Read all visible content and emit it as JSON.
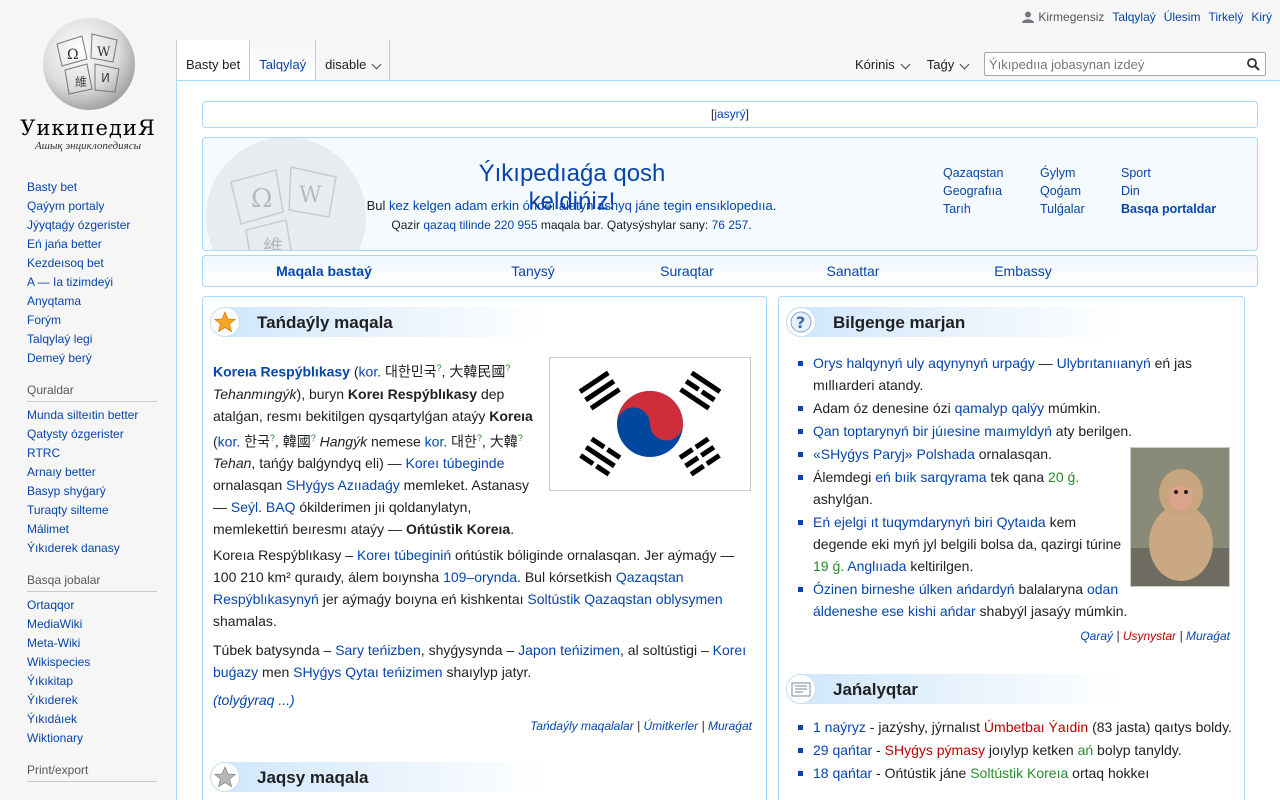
{
  "logo": {
    "wordmark": "УикипедиЯ",
    "tagline": "Ашық энциклопедиясы"
  },
  "personal": {
    "anon": "Kirmegensiz",
    "items": [
      "Talqylaý",
      "Úlesim",
      "Tirkelý",
      "Kirý"
    ]
  },
  "tabs": {
    "left": [
      "Basty bet",
      "Talqylaý",
      "disable"
    ],
    "right": [
      "Kórinis",
      "Taǵy"
    ]
  },
  "search": {
    "placeholder": "Ýıkıpedııa jobasynan izdeý"
  },
  "sidebar": {
    "nav": [
      "Basty bet",
      "Qaýym portaly",
      "Jýyqtaǵy ózgerister",
      "Eń jańa better",
      "Kezdeısoq bet",
      "A — Ia tizimdeýi",
      "Anyqtama",
      "Forým",
      "Talqylaý legi",
      "Demeý berý"
    ],
    "tools_title": "Quraldar",
    "tools": [
      "Munda silteıtin better",
      "Qatysty ózgerister",
      "RTRC",
      "Arnaıy better",
      "Basyp shyǵarý",
      "Turaqty silteme",
      "Málimet",
      "Ýıkıderek danasy"
    ],
    "projects_title": "Basqa jobalar",
    "projects": [
      "Ortaqqor",
      "MediaWiki",
      "Meta-Wiki",
      "Wikispecies",
      "Ýıkıkitap",
      "Ýıkıderek",
      "Ýıkıdáıek",
      "Wiktionary"
    ],
    "print_title": "Print/export"
  },
  "hidebox": {
    "label": "jasyrý"
  },
  "welcome": {
    "title": "Ýıkıpedıaǵa qosh keldińiz!",
    "line1_pre": "Bul ",
    "line1_link": "kez kelgen adam erkin óńdeı alatyn ashyq jáne tegin ensıklopedııa",
    "line1_post": ".",
    "line2_pre": "Qazir ",
    "line2_link": "qazaq tilinde",
    "line2_count": "220 955",
    "line2_mid": " maqala bar. Qatysýshylar sany: ",
    "line2_users": "76 257",
    "line2_post": "."
  },
  "portals": [
    "Qazaqstan",
    "Ǵylym",
    "Sport",
    "Geografııa",
    "Qoǵam",
    "Din",
    "Tarıh",
    "Tulǵalar",
    "Basqa portaldar"
  ],
  "navbar": [
    "Maqala bastaý",
    "Tanysý",
    "Suraqtar",
    "Sanattar",
    "Embassy"
  ],
  "featured": {
    "title": "Tańdaýly maqala",
    "p1": {
      "a": "Koreıa Respýblıkasy",
      "b": " (",
      "c": "kor.",
      "d": " 대한민국",
      "e": "?",
      "f": ", 大韓民國",
      "g": "?",
      "h": "Tehanmıngýk",
      "i": "), buryn ",
      "j": "Koreı Respýblıkasy",
      "k": " dep atalǵan, resmı bekitilgen qysqartylǵan ataýy ",
      "l": "Koreıa",
      "m": " (",
      "n": "kor.",
      "o": " 한국",
      "p": "?",
      "q": ", 韓國",
      "r": "?",
      "s": " Hangýk",
      "t": " nemese ",
      "u": "kor.",
      "v": " 대한",
      "w": "?",
      "x": ", 大韓",
      "y": "?",
      "z": "Tehan",
      "aa": ", tańǵy balǵyndyq eli) — ",
      "ab": "Koreı túbeginde",
      "ac": " ornalasqan ",
      "ad": "SHyǵys Azııadaǵy",
      "ae": " memleket. Astanasy — ",
      "af": "Seýl",
      "ag": ". ",
      "ah": "BAQ",
      "ai": " ókilderimen jıi qoldanylatyn, memlekettiń beıresmı ataýy — ",
      "aj": "Ońtústik Koreıa",
      "ak": "."
    },
    "p2": {
      "a": "Koreıa Respýblıkasy – ",
      "b": "Koreı túbeginiń",
      "c": " ońtústik bóliginde ornalasqan. Jer aýmaǵy — 100 210 km² quraıdy, álem boıynsha ",
      "d": "109–orynda",
      "e": ". Bul kórsetkish ",
      "f": "Qazaqstan Respýblıkasynyń",
      "g": " jer aýmaǵy boıyna eń kishkentaı ",
      "h": "Soltústik Qazaqstan oblysymen",
      "i": " shamalas."
    },
    "p3": {
      "a": "Túbek batysynda – ",
      "b": "Sary teńizben",
      "c": ", shyǵysynda – ",
      "d": "Japon teńizimen",
      "e": ", al soltústigi – ",
      "f": "Koreı buǵazy",
      "g": " men ",
      "h": "SHyǵys Qytaı teńizimen",
      "i": " shaıylyp jatyr."
    },
    "more": "(tolyǵyraq ...)",
    "footer": [
      "Tańdaýly maqalalar",
      "Úmitkerler",
      "Muraǵat"
    ]
  },
  "good": {
    "title": "Jaqsy maqala"
  },
  "dyk": {
    "title": "Bilgenge marjan",
    "items": [
      {
        "a": "Orys halqynyń uly aqynynyń urpaǵy",
        "b": " — ",
        "c": "Ulybrıtanııanyń",
        "d": " eń jas mıllıarderi atandy."
      },
      {
        "a": "Adam óz denesine ózi ",
        "b": "qamalyp qalýy",
        "c": " múmkin."
      },
      {
        "a": "Qan toptarynyń bir júıesine maımyldyń",
        "b": " aty berilgen."
      },
      {
        "a": "«SHyǵys Paryj» ",
        "b": "Polshada",
        "c": " ornalasqan."
      },
      {
        "a": "Álemdegi ",
        "b": "eń bıik sarqyrama",
        "c": " tek qana ",
        "d": "20 ǵ.",
        "e": " ashylǵan."
      },
      {
        "a": "Eń ejelgi ıt tuqymdarynyń biri",
        "b": " ",
        "c": "Qytaıda",
        "d": " kem degende eki myń jyl belgili bolsa da, qazirgi túrine ",
        "e": "19 ǵ.",
        "f": " ",
        "g": "Anglııada",
        "h": " keltirilgen."
      },
      {
        "a": "Ózinen birneshe úlken ańdardyń",
        "b": " balalaryna ",
        "c": "odan áldeneshe ese kishi ańdar",
        "d": " shabyýl jasaýy múmkin."
      }
    ],
    "footer": [
      "Qaraý",
      "Usynystar",
      "Muraǵat"
    ]
  },
  "news": {
    "title": "Jańalyqtar",
    "items": [
      {
        "a": "1 naýryz",
        "b": " - jazýshy, jýrnalıst ",
        "c": "Úmbetbaı Ýaıdin",
        "d": " (83 jasta) qaıtys boldy."
      },
      {
        "a": "29 qańtar",
        "b": " - ",
        "c": "SHyǵys pýmasy",
        "d": " joıylyp ketken ",
        "e": "ań",
        "f": " bolyp tanyldy."
      },
      {
        "a": "18 qańtar",
        "b": " - Ońtústik jáne ",
        "c": "Soltústik Koreıa",
        "d": " ortaq hokkeı"
      }
    ]
  }
}
